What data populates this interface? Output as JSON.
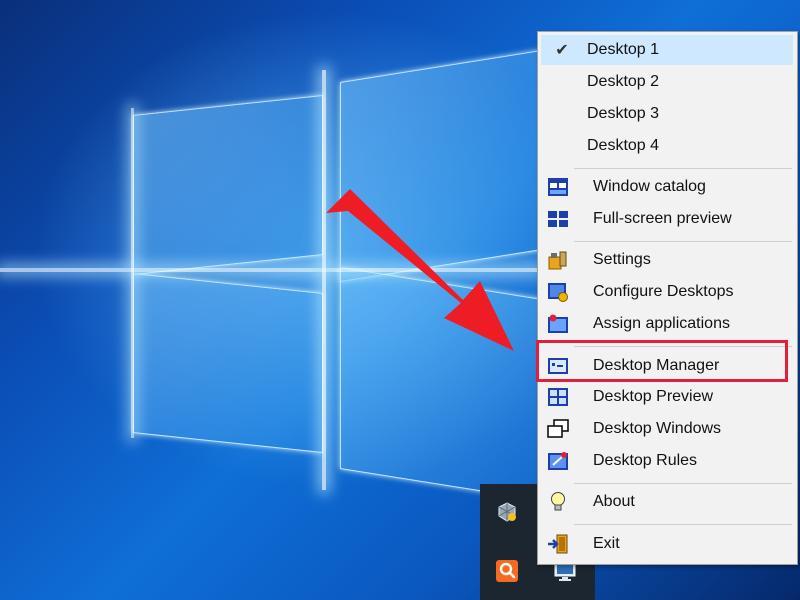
{
  "menu": {
    "desktops": [
      {
        "label": "Desktop 1",
        "checked": true
      },
      {
        "label": "Desktop 2",
        "checked": false
      },
      {
        "label": "Desktop 3",
        "checked": false
      },
      {
        "label": "Desktop 4",
        "checked": false
      }
    ],
    "items": [
      {
        "label": "Window catalog",
        "icon": "window-catalog-icon"
      },
      {
        "label": "Full-screen preview",
        "icon": "fullscreen-preview-icon"
      },
      {
        "label": "Settings",
        "icon": "settings-icon"
      },
      {
        "label": "Configure Desktops",
        "icon": "configure-desktops-icon"
      },
      {
        "label": "Assign applications",
        "icon": "assign-applications-icon"
      },
      {
        "label": "Desktop Manager",
        "icon": "desktop-manager-icon"
      },
      {
        "label": "Desktop Preview",
        "icon": "desktop-preview-icon"
      },
      {
        "label": "Desktop Windows",
        "icon": "desktop-windows-icon"
      },
      {
        "label": "Desktop Rules",
        "icon": "desktop-rules-icon"
      },
      {
        "label": "About",
        "icon": "lightbulb-icon"
      },
      {
        "label": "Exit",
        "icon": "exit-door-icon"
      }
    ],
    "highlighted_item": "Desktop Manager"
  },
  "colors": {
    "highlight_border": "#e0203a",
    "arrow": "#ee1c25",
    "checked_bg": "#cde8ff"
  },
  "taskbar": {
    "icons": [
      "virtualbox-tray-icon",
      "search-app-tray-icon",
      "monitor-tray-icon"
    ]
  }
}
